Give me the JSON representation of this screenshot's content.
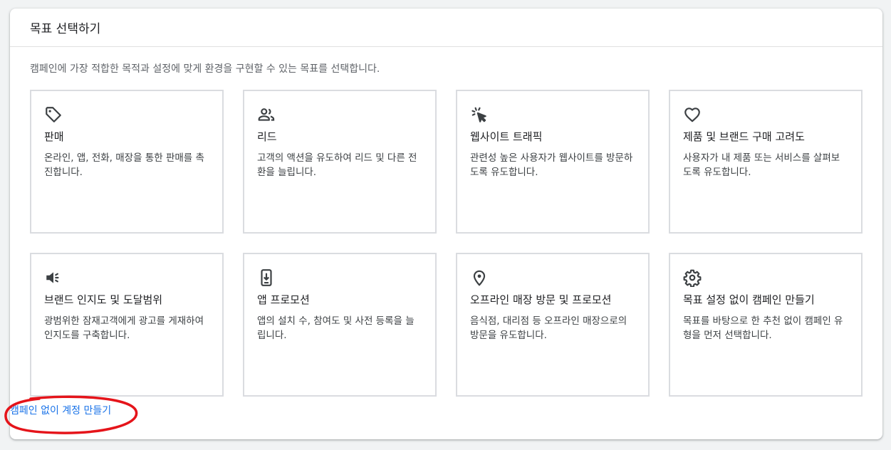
{
  "header": {
    "title": "목표 선택하기"
  },
  "description": "캠페인에 가장 적합한 목적과 설정에 맞게 환경을 구현할 수 있는 목표를 선택합니다.",
  "goals": [
    {
      "title": "판매",
      "desc": "온라인, 앱, 전화, 매장을 통한 판매를 촉진합니다.",
      "icon": "tag-icon"
    },
    {
      "title": "리드",
      "desc": "고객의 액션을 유도하여 리드 및 다른 전환을 늘립니다.",
      "icon": "people-icon"
    },
    {
      "title": "웹사이트 트래픽",
      "desc": "관련성 높은 사용자가 웹사이트를 방문하도록 유도합니다.",
      "icon": "cursor-click-icon"
    },
    {
      "title": "제품 및 브랜드 구매 고려도",
      "desc": "사용자가 내 제품 또는 서비스를 살펴보도록 유도합니다.",
      "icon": "heart-icon"
    },
    {
      "title": "브랜드 인지도 및 도달범위",
      "desc": "광범위한 잠재고객에게 광고를 게재하여 인지도를 구축합니다.",
      "icon": "megaphone-icon"
    },
    {
      "title": "앱 프로모션",
      "desc": "앱의 설치 수, 참여도 및 사전 등록을 늘립니다.",
      "icon": "phone-download-icon"
    },
    {
      "title": "오프라인 매장 방문 및 프로모션",
      "desc": "음식점, 대리점 등 오프라인 매장으로의 방문을 유도합니다.",
      "icon": "location-pin-icon"
    },
    {
      "title": "목표 설정 없이 캠페인 만들기",
      "desc": "목표를 바탕으로 한 추천 없이 캠페인 유형을 먼저 선택합니다.",
      "icon": "gear-icon"
    }
  ],
  "footer": {
    "link_label": "캠페인 없이 계정 만들기"
  },
  "colors": {
    "link": "#1a73e8",
    "annotation": "#e5141a",
    "tile_border": "#dadce0"
  }
}
